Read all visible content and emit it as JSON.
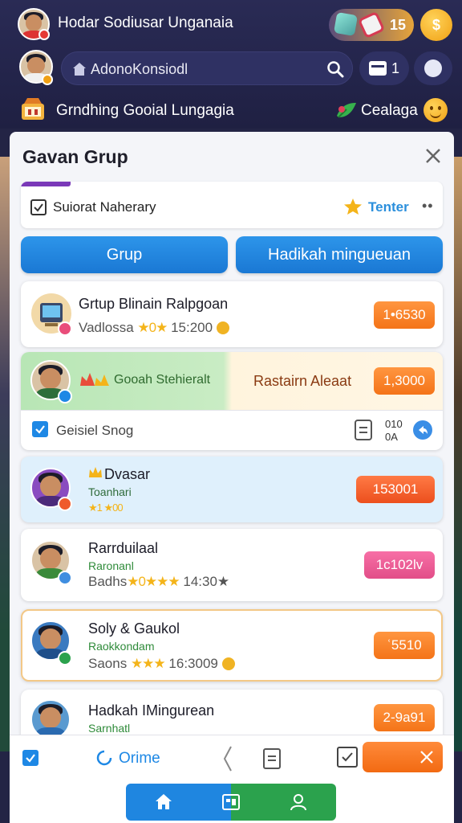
{
  "header": {
    "user_name": "Hodar Sodiusar Unganaia",
    "coin_count": "15",
    "coin_symbol": "$",
    "search_placeholder": "AdonoKonsiodl",
    "inbox_count": "1",
    "section_title": "Grndhing Gooial Lungagia",
    "right_label": "Cealaga"
  },
  "modal": {
    "title": "Gavan Grup",
    "filter_label": "Suiorat Naherary",
    "trend_label": "Tenter",
    "more_label": "••",
    "tabs": [
      "Grup",
      "Hadikah mingueuan"
    ]
  },
  "cards": [
    {
      "name": "Grtup Blinain Ralpgoan",
      "meta_prefix": "Vadlossa",
      "stars": "★0★",
      "time": "15:200",
      "price": "1•6530",
      "badge_color": "#e94d7a"
    },
    {
      "name_left": "Gooah Stehieralt",
      "name_right": "Rastairn Aleaat",
      "price": "1,3000",
      "badge_color": "#1e88e5"
    },
    {
      "check_label": "Geisiel Snog",
      "time_top": "010",
      "time_bottom": "0A"
    },
    {
      "name": "Dvasar",
      "sub": "Toanhari",
      "stars": "★1 ★00",
      "price": "153001",
      "badge_color": "#ef5a2c"
    },
    {
      "name": "Rarrduilaal",
      "sub": "Raronanl",
      "meta_prefix": "Badhs",
      "stars": "★0★★★",
      "time": "14:30★",
      "price": "1c102lv",
      "badge_color": "#3f8ee0"
    },
    {
      "name": "Soly & Gaukol",
      "sub": "Raokkondam",
      "meta_prefix": "Saons",
      "stars": "★★★",
      "time": "16:3009",
      "price": "ʿ5510",
      "badge_color": "#2ba24d"
    },
    {
      "name": "Hadkah IMingurean",
      "sub": "Sarnhatl",
      "price": "2-9a91",
      "badge_color": "#e9a130"
    }
  ],
  "footer": {
    "online_label": "Orime"
  },
  "colors": {
    "accent_blue": "#1e88e5",
    "accent_orange": "#f47418",
    "accent_purple": "#7a39b8",
    "accent_green": "#2ba24d"
  }
}
